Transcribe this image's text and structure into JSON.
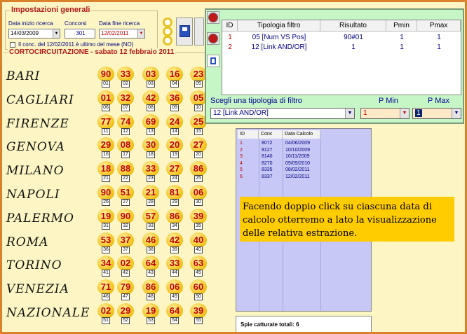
{
  "settings": {
    "title": "Impostazioni generali",
    "start_label": "Data inizio ricerca",
    "start_value": "14/03/2009",
    "count_label": "Concorsi",
    "count_value": "301",
    "end_label": "Data fine ricerca",
    "end_value": "12/02/2011",
    "checkbox_label": "Il conc. del 12/02/2011 è ultimo del mese (NO)"
  },
  "draws": {
    "title": "CORTOCIRCUITAZIONE - sabato 12 febbraio 2011",
    "wheels": [
      {
        "city": "BARI",
        "numbers": [
          "90",
          "33",
          "03",
          "16",
          "23"
        ],
        "positions": [
          "01",
          "02",
          "03",
          "04",
          "05"
        ]
      },
      {
        "city": "CAGLIARI",
        "numbers": [
          "01",
          "32",
          "42",
          "36",
          "05"
        ],
        "positions": [
          "06",
          "07",
          "08",
          "09",
          "10"
        ]
      },
      {
        "city": "FIRENZE",
        "numbers": [
          "77",
          "74",
          "69",
          "24",
          "25"
        ],
        "positions": [
          "11",
          "12",
          "13",
          "14",
          "15"
        ]
      },
      {
        "city": "GENOVA",
        "numbers": [
          "29",
          "08",
          "30",
          "20",
          "27"
        ],
        "positions": [
          "16",
          "17",
          "18",
          "19",
          "20"
        ]
      },
      {
        "city": "MILANO",
        "numbers": [
          "18",
          "88",
          "33",
          "27",
          "86"
        ],
        "positions": [
          "21",
          "22",
          "23",
          "24",
          "25"
        ]
      },
      {
        "city": "NAPOLI",
        "numbers": [
          "90",
          "51",
          "21",
          "81",
          "06"
        ],
        "positions": [
          "26",
          "27",
          "28",
          "29",
          "30"
        ]
      },
      {
        "city": "PALERMO",
        "numbers": [
          "19",
          "90",
          "57",
          "86",
          "39"
        ],
        "positions": [
          "31",
          "32",
          "33",
          "34",
          "35"
        ]
      },
      {
        "city": "ROMA",
        "numbers": [
          "53",
          "37",
          "46",
          "42",
          "40"
        ],
        "positions": [
          "36",
          "37",
          "38",
          "39",
          "40"
        ]
      },
      {
        "city": "TORINO",
        "numbers": [
          "34",
          "02",
          "64",
          "33",
          "63"
        ],
        "positions": [
          "41",
          "42",
          "43",
          "44",
          "45"
        ]
      },
      {
        "city": "VENEZIA",
        "numbers": [
          "71",
          "79",
          "86",
          "06",
          "60"
        ],
        "positions": [
          "46",
          "47",
          "48",
          "49",
          "50"
        ]
      },
      {
        "city": "NAZIONALE",
        "numbers": [
          "02",
          "29",
          "19",
          "64",
          "39"
        ],
        "positions": [
          "51",
          "52",
          "53",
          "54",
          "55"
        ]
      }
    ]
  },
  "filter": {
    "headers": [
      "ID",
      "Tipologia filtro",
      "Risultato",
      "Pmin",
      "Pmax"
    ],
    "rows": [
      {
        "id": "1",
        "type": "05 [Num VS Pos]",
        "result": "90#01",
        "pmin": "1",
        "pmax": "1"
      },
      {
        "id": "2",
        "type": "12 [Link AND/OR]",
        "result": "1",
        "pmin": "1",
        "pmax": "1"
      }
    ],
    "select_label": "Scegli una tipologia di filtro",
    "select_value": "12 [Link AND/OR]",
    "pmin_label": "P Min",
    "pmin_value": "1",
    "pmax_label": "P Max",
    "pmax_value": "1"
  },
  "results": {
    "headers": [
      "ID",
      "Conc",
      "Data Calcolo"
    ],
    "rows": [
      {
        "id": "1",
        "conc": "8072",
        "date": "04/06/2009"
      },
      {
        "id": "2",
        "conc": "8127",
        "date": "10/10/2009"
      },
      {
        "id": "3",
        "conc": "8140",
        "date": "10/11/2009"
      },
      {
        "id": "4",
        "conc": "8270",
        "date": "09/09/2010"
      },
      {
        "id": "5",
        "conc": "8335",
        "date": "08/02/2011"
      },
      {
        "id": "6",
        "conc": "8337",
        "date": "12/02/2011"
      }
    ],
    "note": "Facendo doppio click su ciascuna data di calcolo otterremo a lato la visualizzazione delle relativa estrazione.",
    "total_label": "Spie catturate totali: 6"
  },
  "colors": {
    "accent_red": "#b01818",
    "ball_yellow": "#f3c21a",
    "filter_green": "#c6f5c6",
    "results_blue": "#c8c8f6",
    "note_yellow": "#ffcc00"
  }
}
